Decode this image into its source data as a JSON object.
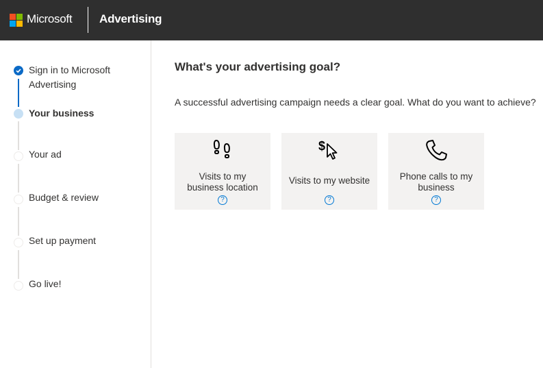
{
  "header": {
    "brand": "Microsoft",
    "product": "Advertising",
    "logo_colors": [
      "#f25022",
      "#7fba00",
      "#00a4ef",
      "#ffb900"
    ]
  },
  "sidebar": {
    "steps": [
      {
        "label_line1": "Sign in to Microsoft",
        "label_line2": "Advertising",
        "state": "completed"
      },
      {
        "label": "Your business",
        "state": "current"
      },
      {
        "label": "Your ad",
        "state": "pending"
      },
      {
        "label": "Budget & review",
        "state": "pending"
      },
      {
        "label": "Set up payment",
        "state": "pending"
      },
      {
        "label": "Go live!",
        "state": "pending"
      }
    ]
  },
  "main": {
    "title": "What's your advertising goal?",
    "subtitle": "A successful advertising campaign needs a clear goal. What do you want to achieve?",
    "goals": [
      {
        "icon": "footprints-icon",
        "line1": "Visits to my",
        "line2": "business location",
        "help": "?"
      },
      {
        "icon": "dollar-cursor-icon",
        "line1": "Visits to my website",
        "help": "?"
      },
      {
        "icon": "phone-icon",
        "line1": "Phone calls to my",
        "line2": "business",
        "help": "?"
      }
    ]
  },
  "colors": {
    "accent": "#0b6ac6",
    "current_step": "#c7e0f4",
    "header_bg": "#2f2f2f",
    "card_bg": "#f3f2f1"
  }
}
